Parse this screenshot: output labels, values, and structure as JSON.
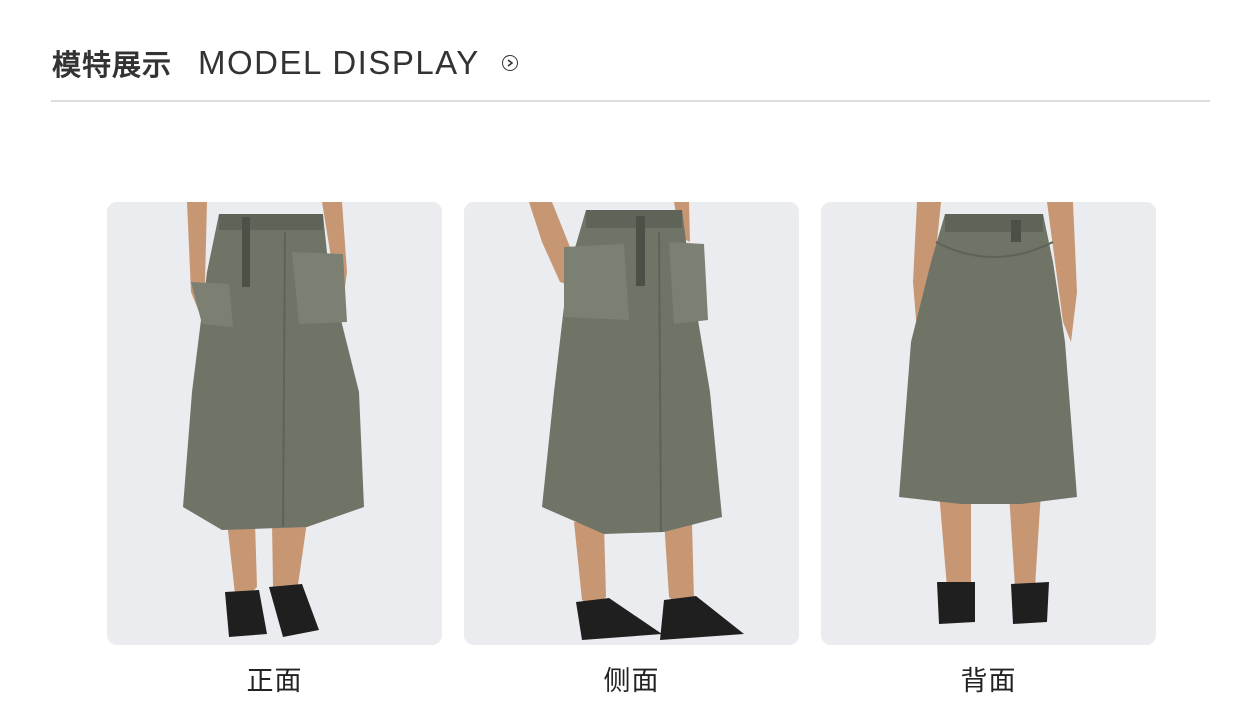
{
  "header": {
    "title_cn": "模特展示",
    "title_en": "MODEL DISPLAY",
    "arrow_icon": "circle-arrow-right-icon"
  },
  "photos": [
    {
      "caption": "正面"
    },
    {
      "caption": "侧面"
    },
    {
      "caption": "背面"
    }
  ],
  "colors": {
    "skirt": "#6f7467",
    "background": "#ebecf0",
    "skin": "#c79774",
    "sandal": "#1f1f1f"
  }
}
